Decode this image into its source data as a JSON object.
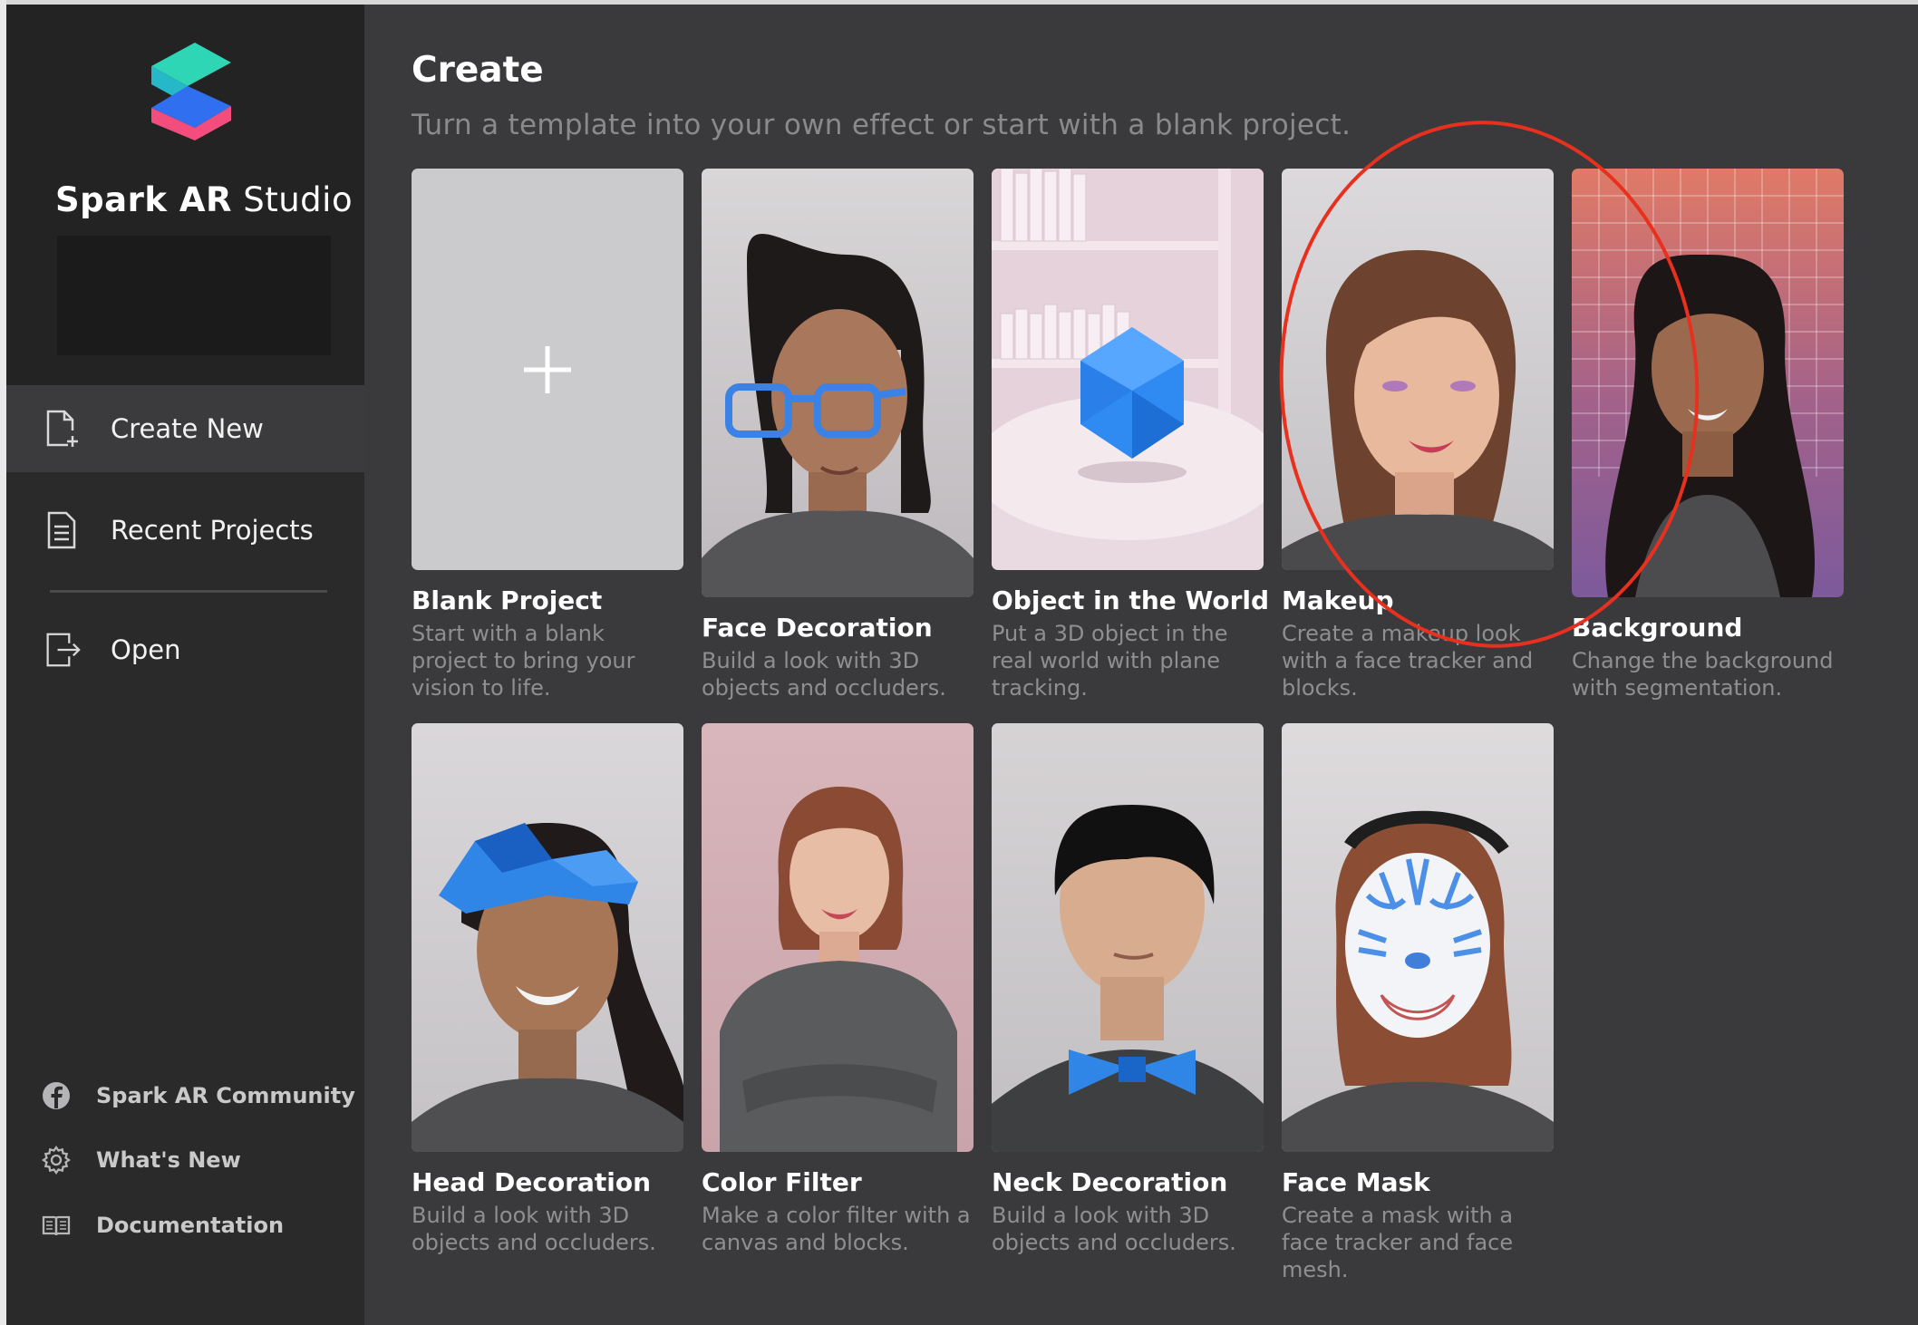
{
  "app": {
    "name_bold": "Spark AR",
    "name_light": " Studio"
  },
  "sidebar": {
    "nav": [
      {
        "label": "Create New",
        "icon": "new-file-icon",
        "active": true
      },
      {
        "label": "Recent Projects",
        "icon": "document-icon",
        "active": false
      },
      {
        "label": "Open",
        "icon": "open-file-icon",
        "active": false
      }
    ],
    "footer": [
      {
        "label": "Spark AR Community",
        "icon": "facebook-icon"
      },
      {
        "label": "What's New",
        "icon": "gear-icon"
      },
      {
        "label": "Documentation",
        "icon": "book-icon"
      }
    ]
  },
  "main": {
    "title": "Create",
    "subtitle": "Turn a template into your own effect or start with a blank project.",
    "templates": [
      {
        "title": "Blank Project",
        "description": "Start with a blank project to bring your vision to life."
      },
      {
        "title": "Face Decoration",
        "description": "Build a look with 3D objects and occluders."
      },
      {
        "title": "Object in the World",
        "description": "Put a 3D object in the real world with plane tracking."
      },
      {
        "title": "Makeup",
        "description": "Create a makeup look with a face tracker and blocks."
      },
      {
        "title": "Background",
        "description": "Change the background with segmentation."
      },
      {
        "title": "Head Decoration",
        "description": "Build a look with 3D objects and occluders."
      },
      {
        "title": "Color Filter",
        "description": "Make a color filter with a canvas and blocks."
      },
      {
        "title": "Neck Decoration",
        "description": "Build a look with 3D objects and occluders."
      },
      {
        "title": "Face Mask",
        "description": "Create a mask with a face tracker and face mesh."
      }
    ]
  },
  "colors": {
    "accent_annotation": "#e8301f",
    "sidebar_bg": "#2a2a2b",
    "main_bg": "#3a3a3c",
    "logo_teal": "#2fd6b5",
    "logo_blue": "#2f6ff0",
    "logo_pink": "#f24d7c"
  }
}
